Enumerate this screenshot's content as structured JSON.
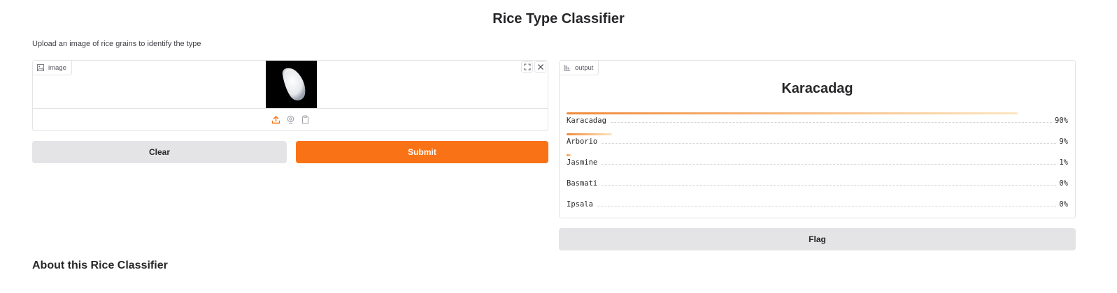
{
  "app": {
    "title": "Rice Type Classifier",
    "description": "Upload an image of rice grains to identify the type"
  },
  "input": {
    "tag_label": "image",
    "tag_icon": "image-icon",
    "toolbar_icons": [
      "upload-icon",
      "webcam-icon",
      "clipboard-icon"
    ],
    "corner_icons": [
      "fullscreen-icon",
      "close-icon"
    ]
  },
  "buttons": {
    "clear": "Clear",
    "submit": "Submit",
    "flag": "Flag"
  },
  "output": {
    "tag_label": "output",
    "tag_icon": "label-icon",
    "top_label": "Karacadag",
    "confidences": [
      {
        "label": "Karacadag",
        "value": 0.9,
        "display": "90%"
      },
      {
        "label": "Arborio",
        "value": 0.09,
        "display": "9%"
      },
      {
        "label": "Jasmine",
        "value": 0.01,
        "display": "1%"
      },
      {
        "label": "Basmati",
        "value": 0.0,
        "display": "0%"
      },
      {
        "label": "Ipsala",
        "value": 0.0,
        "display": "0%"
      }
    ]
  },
  "about": {
    "heading": "About this Rice Classifier"
  },
  "colors": {
    "accent": "#f97316",
    "neutral_button": "#e4e4e7",
    "border": "#e4e4e7"
  }
}
